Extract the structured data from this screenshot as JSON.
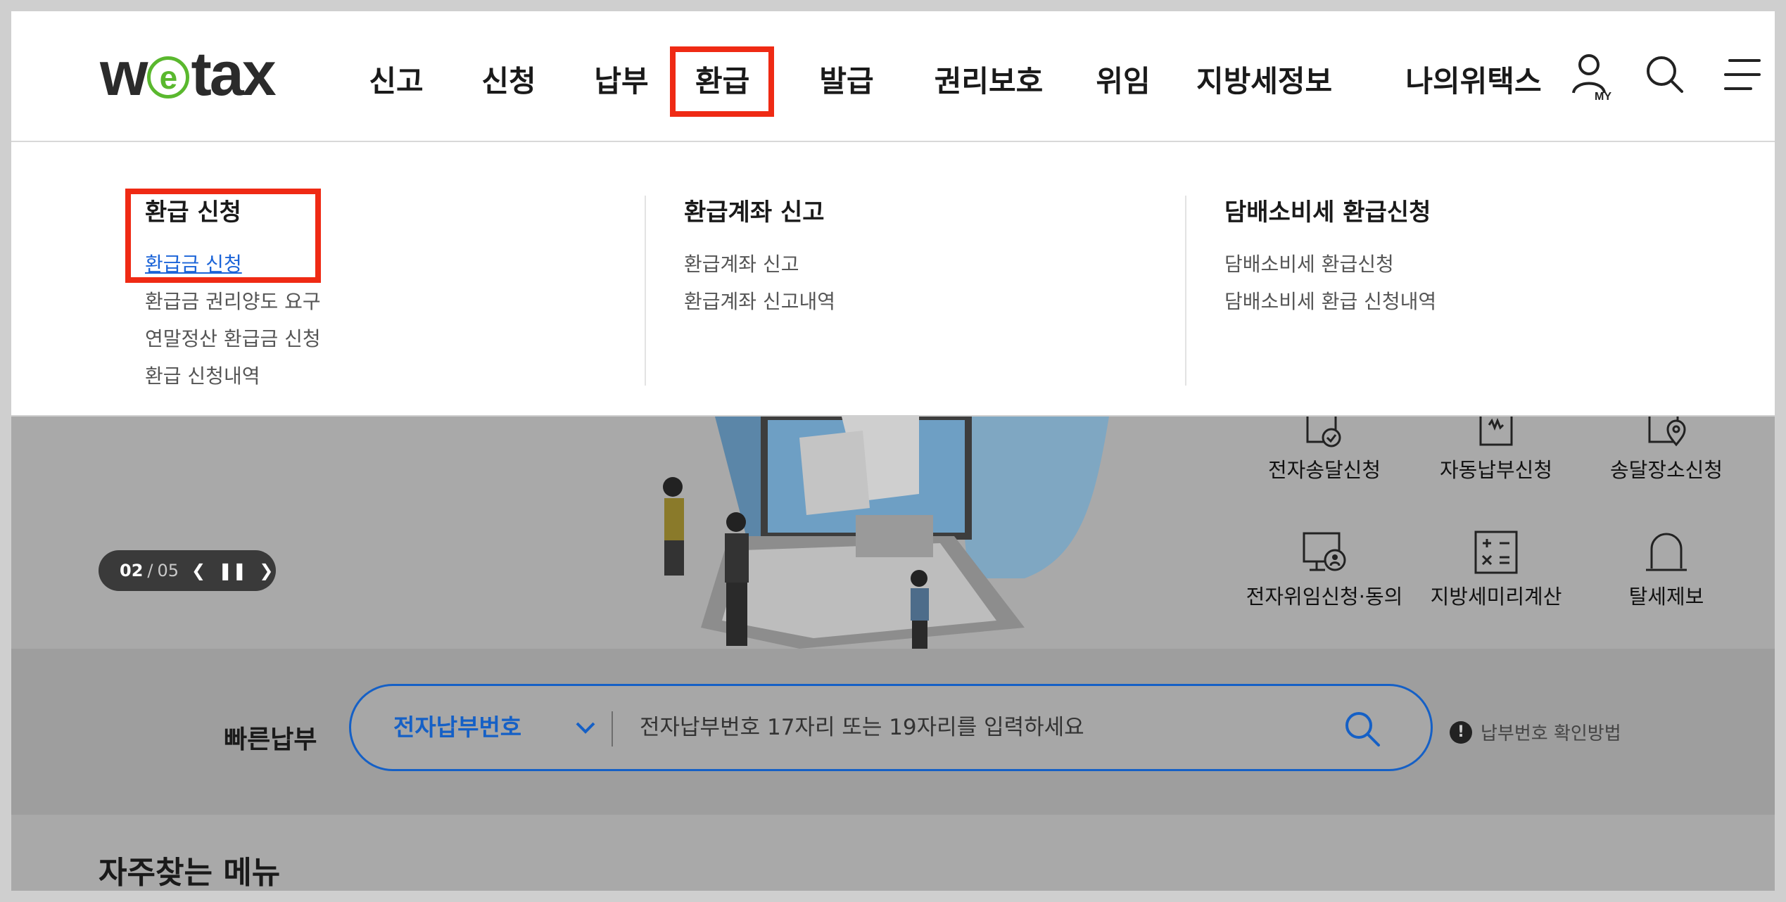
{
  "logo": {
    "text_pre": "w",
    "text_e": "e",
    "text_post": "tax"
  },
  "nav": {
    "items": [
      {
        "label": "신고"
      },
      {
        "label": "신청"
      },
      {
        "label": "납부"
      },
      {
        "label": "환급"
      },
      {
        "label": "발급"
      },
      {
        "label": "권리보호"
      },
      {
        "label": "위임"
      },
      {
        "label": "지방세정보"
      },
      {
        "label": "나의위택스"
      }
    ],
    "my_badge": "MY",
    "icons": [
      "user-my-icon",
      "search-icon",
      "hamburger-menu-icon"
    ]
  },
  "dropdown": {
    "columns": [
      {
        "title": "환급 신청",
        "links": [
          "환급금 신청",
          "환급금 권리양도 요구",
          "연말정산 환급금 신청",
          "환급 신청내역"
        ]
      },
      {
        "title": "환급계좌 신고",
        "links": [
          "환급계좌 신고",
          "환급계좌 신고내역"
        ]
      },
      {
        "title": "담배소비세 환급신청",
        "links": [
          "담배소비세 환급신청",
          "담배소비세 환급 신청내역"
        ]
      }
    ]
  },
  "banner": {
    "counter": {
      "current": "02",
      "separator": "/",
      "total": "05"
    },
    "quick_menu": [
      {
        "label": "전자송달신청",
        "icon": "e-delivery-icon"
      },
      {
        "label": "자동납부신청",
        "icon": "auto-pay-icon"
      },
      {
        "label": "송달장소신청",
        "icon": "delivery-place-icon"
      },
      {
        "label": "전자위임신청·동의",
        "icon": "e-delegation-icon"
      },
      {
        "label": "지방세미리계산",
        "icon": "calculator-icon"
      },
      {
        "label": "탈세제보",
        "icon": "siren-icon"
      }
    ]
  },
  "fastpay": {
    "title": "빠른납부",
    "select_value": "전자납부번호",
    "placeholder": "전자납부번호 17자리 또는 19자리를 입력하세요",
    "help_label": "납부번호 확인방법"
  },
  "frequent": {
    "title": "자주찾는 메뉴"
  },
  "colors": {
    "highlight": "#ef2a14",
    "brand_green": "#5ab82e",
    "accent_blue": "#1560c6",
    "link_blue": "#1b64d8"
  }
}
